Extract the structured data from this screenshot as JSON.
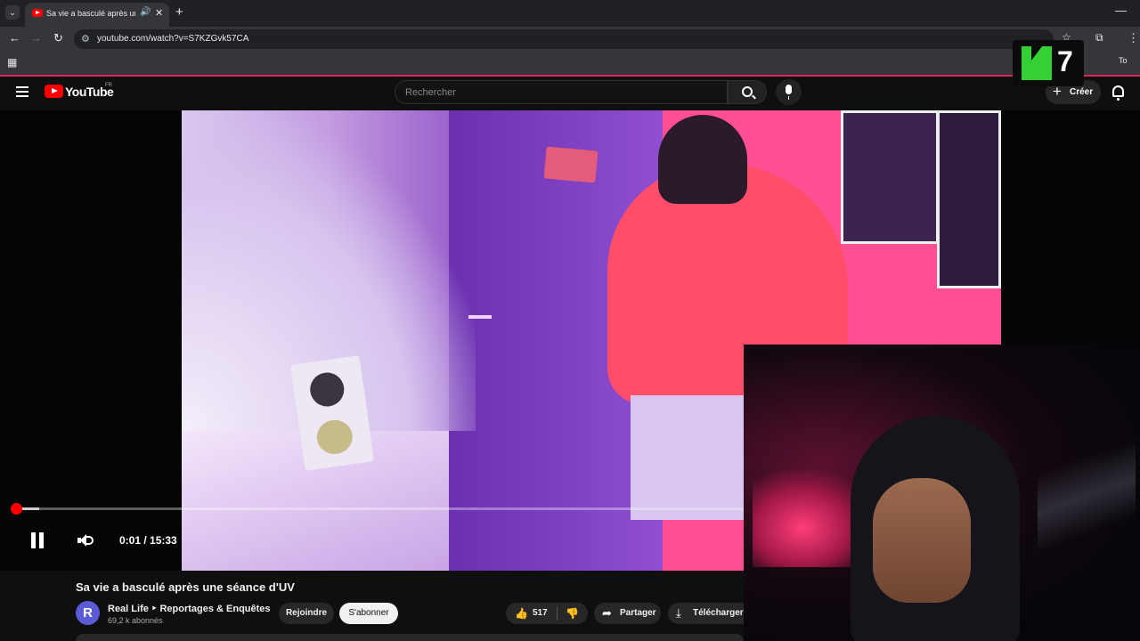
{
  "browser": {
    "tab_title": "Sa vie a basculé après une s",
    "url": "youtube.com/watch?v=S7KZGvk57CA",
    "tab_list_glyph": "⌄",
    "tab_audio_glyph": "🔊",
    "tab_close_glyph": "✕",
    "new_tab_glyph": "+",
    "minimize_glyph": "—",
    "bookmark_fragment": "To"
  },
  "overlay_logo": {
    "letter": "K",
    "number": "7",
    "color": "#34d134"
  },
  "youtube": {
    "brand": "YouTube",
    "region": "FR",
    "search_placeholder": "Rechercher",
    "create_label": "Créer",
    "accent": "#ff0000"
  },
  "player": {
    "time_current": "0:01",
    "time_total": "15:33",
    "time_display": "0:01 / 15:33",
    "progress_fraction": 0.001,
    "state": "playing"
  },
  "video": {
    "title": "Sa vie a basculé après une séance d'UV",
    "channel": {
      "avatar_letter": "R",
      "name": "Real Life ‣ Reportages & Enquêtes",
      "subscribers": "69,2 k abonnés"
    },
    "actions": {
      "join": "Rejoindre",
      "subscribe": "S'abonner",
      "likes": "517",
      "share": "Partager",
      "download": "Télécharger"
    }
  }
}
